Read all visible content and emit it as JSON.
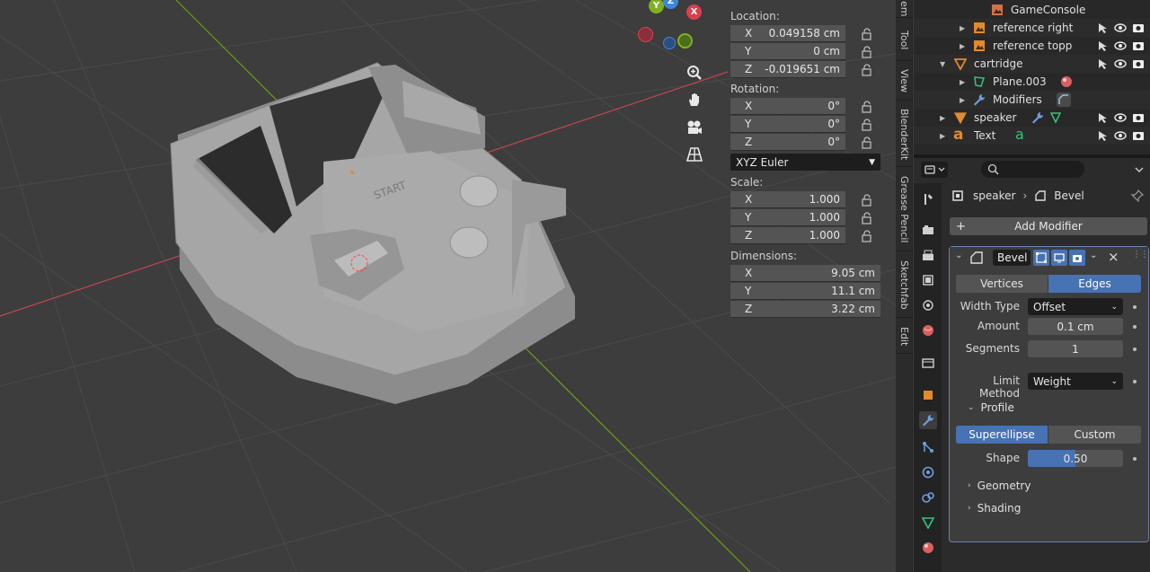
{
  "viewport": {
    "gizmo": {
      "x": "X",
      "y": "Y",
      "z": "Z"
    },
    "colors": {
      "x_axis": "#d9404f",
      "y_axis": "#7fb024",
      "z_axis": "#3f86d8",
      "grid": "#4a4a4a",
      "model": "#a8a8a8"
    }
  },
  "npanel": {
    "location_label": "Location:",
    "location": [
      {
        "axis": "X",
        "value": "0.049158 cm"
      },
      {
        "axis": "Y",
        "value": "0 cm"
      },
      {
        "axis": "Z",
        "value": "-0.019651 cm"
      }
    ],
    "rotation_label": "Rotation:",
    "rotation": [
      {
        "axis": "X",
        "value": "0°"
      },
      {
        "axis": "Y",
        "value": "0°"
      },
      {
        "axis": "Z",
        "value": "0°"
      }
    ],
    "rotation_mode": "XYZ Euler",
    "scale_label": "Scale:",
    "scale": [
      {
        "axis": "X",
        "value": "1.000"
      },
      {
        "axis": "Y",
        "value": "1.000"
      },
      {
        "axis": "Z",
        "value": "1.000"
      }
    ],
    "dimensions_label": "Dimensions:",
    "dimensions": [
      {
        "axis": "X",
        "value": "9.05 cm"
      },
      {
        "axis": "Y",
        "value": "11.1 cm"
      },
      {
        "axis": "Z",
        "value": "3.22 cm"
      }
    ]
  },
  "tabs": [
    "em",
    "Tool",
    "View",
    "BlenderKit",
    "Grease Pencil",
    "Sketchfab",
    "Edit"
  ],
  "outliner": {
    "rows": [
      {
        "name": "GameConsole"
      },
      {
        "name": "reference right"
      },
      {
        "name": "reference topp"
      },
      {
        "name": "cartridge"
      },
      {
        "name": "Plane.003"
      },
      {
        "name": "Modifiers"
      },
      {
        "name": "speaker"
      },
      {
        "name": "Text"
      }
    ]
  },
  "properties": {
    "breadcrumb": {
      "object": "speaker",
      "modifier": "Bevel"
    },
    "add_modifier": "Add Modifier",
    "modifier": {
      "name": "Bevel",
      "affect": {
        "vertices": "Vertices",
        "edges": "Edges"
      },
      "width_type": {
        "label": "Width Type",
        "value": "Offset"
      },
      "amount": {
        "label": "Amount",
        "value": "0.1 cm"
      },
      "segments": {
        "label": "Segments",
        "value": "1"
      },
      "limit_method": {
        "label": "Limit Method",
        "value": "Weight"
      },
      "profile": {
        "label": "Profile",
        "superellipse": "Superellipse",
        "custom": "Custom",
        "shape": {
          "label": "Shape",
          "value": "0.50",
          "fraction": 0.5
        }
      },
      "geometry": "Geometry",
      "shading": "Shading"
    }
  }
}
